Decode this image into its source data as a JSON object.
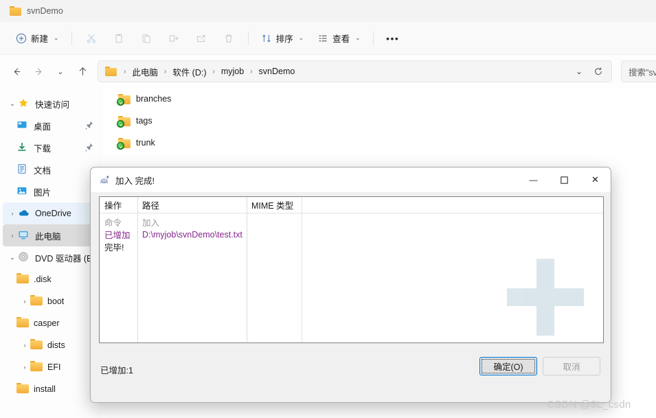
{
  "explorer": {
    "tab": {
      "label": "svnDemo",
      "icon": "folder-icon"
    },
    "toolbar": {
      "new_label": "新建",
      "new_icon": "plus-circle-icon",
      "cut_icon": "scissors-icon",
      "copy_icon": "copy-icon",
      "paste_icon": "paste-icon",
      "rename_icon": "rename-icon",
      "share_icon": "share-icon",
      "delete_icon": "trash-icon",
      "sort_label": "排序",
      "sort_icon": "sort-arrows-icon",
      "view_label": "查看",
      "view_icon": "view-list-icon",
      "more_label": "•••"
    },
    "nav": {
      "back_icon": "arrow-left-icon",
      "forward_icon": "arrow-right-icon",
      "recent_icon": "chevron-down-icon",
      "up_icon": "arrow-up-icon",
      "refresh_icon": "refresh-icon",
      "breadcrumb_chevron_icon": "chevron-down-icon"
    },
    "breadcrumb": {
      "icon": "folder-icon",
      "items": [
        "此电脑",
        "软件 (D:)",
        "myjob",
        "svnDemo"
      ],
      "separator": "›"
    },
    "search": {
      "value": "搜索\"sv"
    },
    "sidebar": [
      {
        "label": "快速访问",
        "icon": "star-icon",
        "chevron": "expanded",
        "indent": 0,
        "state": "normal",
        "pin": false
      },
      {
        "label": "桌面",
        "icon": "desktop-icon",
        "chevron": "none",
        "indent": 1,
        "state": "normal",
        "pin": true
      },
      {
        "label": "下载",
        "icon": "download-icon",
        "chevron": "none",
        "indent": 1,
        "state": "normal",
        "pin": true
      },
      {
        "label": "文档",
        "icon": "document-icon",
        "chevron": "none",
        "indent": 1,
        "state": "normal",
        "pin": false
      },
      {
        "label": "图片",
        "icon": "pictures-icon",
        "chevron": "none",
        "indent": 1,
        "state": "normal",
        "pin": false
      },
      {
        "label": "OneDrive",
        "icon": "onedrive-cloud-icon",
        "chevron": "collapsed",
        "indent": 0,
        "state": "hover",
        "pin": false
      },
      {
        "label": "此电脑",
        "icon": "this-pc-icon",
        "chevron": "collapsed",
        "indent": 0,
        "state": "selected",
        "pin": false
      },
      {
        "label": "DVD 驱动器 (E",
        "icon": "dvd-drive-icon",
        "chevron": "expanded",
        "indent": 0,
        "state": "normal",
        "pin": false
      },
      {
        "label": ".disk",
        "icon": "folder-icon",
        "chevron": "none",
        "indent": 1,
        "state": "normal",
        "pin": false
      },
      {
        "label": "boot",
        "icon": "folder-icon",
        "chevron": "collapsed",
        "indent": 1,
        "state": "normal",
        "pin": false
      },
      {
        "label": "casper",
        "icon": "folder-icon",
        "chevron": "none",
        "indent": 1,
        "state": "normal",
        "pin": false
      },
      {
        "label": "dists",
        "icon": "folder-icon",
        "chevron": "collapsed",
        "indent": 1,
        "state": "normal",
        "pin": false
      },
      {
        "label": "EFI",
        "icon": "folder-icon",
        "chevron": "collapsed",
        "indent": 1,
        "state": "normal",
        "pin": false
      },
      {
        "label": "install",
        "icon": "folder-icon",
        "chevron": "none",
        "indent": 1,
        "state": "normal",
        "pin": false
      }
    ],
    "files": [
      {
        "name": "branches",
        "icon": "folder-icon",
        "overlay": "svn-added-check"
      },
      {
        "name": "tags",
        "icon": "folder-icon",
        "overlay": "svn-added-check"
      },
      {
        "name": "trunk",
        "icon": "folder-icon",
        "overlay": "svn-added-check"
      }
    ]
  },
  "dialog": {
    "title": "加入 完成!",
    "icon": "tortoisesvn-icon",
    "window_controls": {
      "minimize": "—",
      "maximize": "☐",
      "close": "✕"
    },
    "background_icon": "plus-watermark-icon",
    "columns": [
      "操作",
      "路径",
      "MIME 类型"
    ],
    "rows": [
      {
        "operation": "命令",
        "path": "加入",
        "mime": "",
        "color": "#9a9a9a"
      },
      {
        "operation": "已增加",
        "path": "D:\\myjob\\svnDemo\\test.txt",
        "mime": "",
        "color": "#86278c"
      },
      {
        "operation": "完毕!",
        "path": "",
        "mime": "",
        "color": "#1b1b1b"
      }
    ],
    "status": "已增加:1",
    "ok_button": "确定(O)",
    "cancel_button": "取消"
  },
  "watermark": "CSDN @3L_csdn",
  "colors": {
    "accent": "#0078d7",
    "svn_added": "#86278c",
    "plus_watermark": "#bed3dd"
  }
}
